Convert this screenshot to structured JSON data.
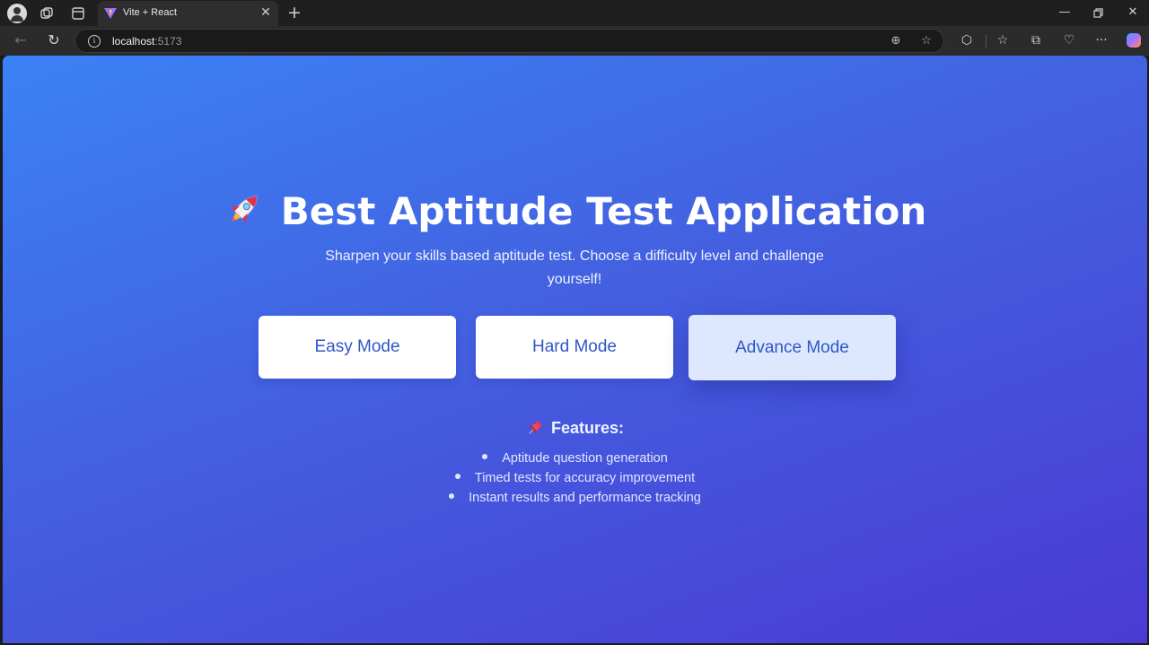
{
  "browser": {
    "tab": {
      "title": "Vite + React"
    },
    "address": {
      "host": "localhost",
      "port": ":5173"
    }
  },
  "page": {
    "heading": "Best Aptitude Test Application",
    "subtitle": "Sharpen your skills based aptitude test. Choose a difficulty level and challenge yourself!",
    "modes": [
      {
        "label": "Easy Mode"
      },
      {
        "label": "Hard Mode"
      },
      {
        "label": "Advance Mode",
        "active": true
      }
    ],
    "features": {
      "title": "Features:",
      "items": [
        "Aptitude question generation",
        "Timed tests for accuracy improvement",
        "Instant results and performance tracking"
      ]
    },
    "colors": {
      "gradient_start": "#3b82f6",
      "gradient_end": "#4a3ad4",
      "button_text": "#2f56c8",
      "active_button_bg": "#dde8ff"
    }
  }
}
